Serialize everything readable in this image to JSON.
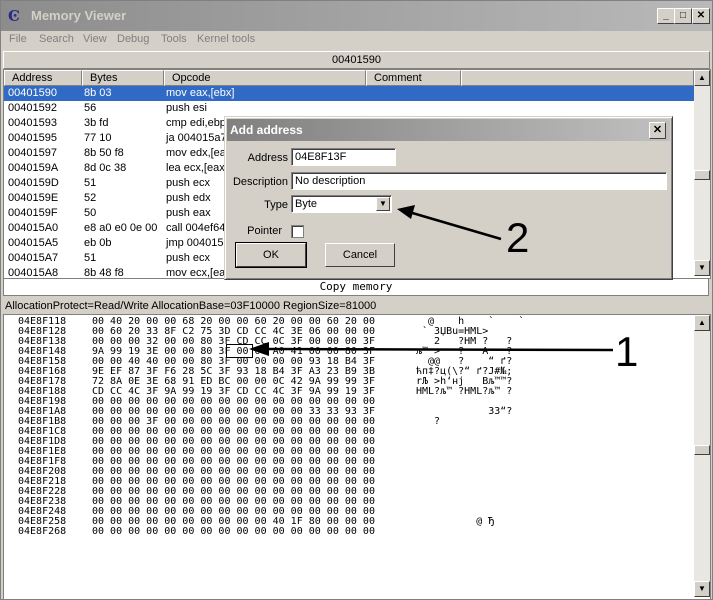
{
  "window": {
    "title": "Memory Viewer",
    "icon": "cheat-engine-icon"
  },
  "menu": [
    "File",
    "Search",
    "View",
    "Debug",
    "Tools",
    "Kernel tools"
  ],
  "address_bar": "00401590",
  "disasm": {
    "columns": [
      "Address",
      "Bytes",
      "Opcode",
      "Comment"
    ],
    "rows": [
      {
        "address": "00401590",
        "bytes": "8b 03",
        "opcode": "mov eax,[ebx]",
        "selected": true
      },
      {
        "address": "00401592",
        "bytes": "56",
        "opcode": "push esi"
      },
      {
        "address": "00401593",
        "bytes": "3b fd",
        "opcode": "cmp edi,ebp"
      },
      {
        "address": "00401595",
        "bytes": "77 10",
        "opcode": "ja 004015a7"
      },
      {
        "address": "00401597",
        "bytes": "8b 50 f8",
        "opcode": "mov edx,[eax"
      },
      {
        "address": "0040159A",
        "bytes": "8d 0c 38",
        "opcode": "lea ecx,[eax"
      },
      {
        "address": "0040159D",
        "bytes": "51",
        "opcode": "push ecx"
      },
      {
        "address": "0040159E",
        "bytes": "52",
        "opcode": "push edx"
      },
      {
        "address": "0040159F",
        "bytes": "50",
        "opcode": "push eax"
      },
      {
        "address": "004015A0",
        "bytes": "e8 a0 e0 0e 00",
        "opcode": "call 004ef64"
      },
      {
        "address": "004015A5",
        "bytes": "eb 0b",
        "opcode": "jmp 004015b"
      },
      {
        "address": "004015A7",
        "bytes": "51",
        "opcode": "push ecx"
      },
      {
        "address": "004015A8",
        "bytes": "8b 48 f8",
        "opcode": "mov ecx,[ea"
      }
    ]
  },
  "copy_memory_label": "Copy memory",
  "status": "AllocationProtect=Read/Write  AllocationBase=03F10000 RegionSize=81000",
  "hex": [
    {
      "addr": "04E8F118",
      "bytes": "00 40 20 00 00 68 20 00 00 60 20 00 00 60 20 00",
      "ascii": "  @    h    `    `"
    },
    {
      "addr": "04E8F128",
      "bytes": "00 60 20 33 8F C2 75 3D CD CC 4C 3E 06 00 00 00",
      "ascii": " ` 3ЏВu=НМL>"
    },
    {
      "addr": "04E8F138",
      "bytes": "00 00 00 32 00 00 80 3F CD CC 0C 3F 00 00 00 3F",
      "ascii": "   2   ?НМ ?   ?"
    },
    {
      "addr": "04E8F148",
      "bytes": "9A 99 19 3E 00 00 80 3F 00 00 A0 41 00 00 80 3F",
      "ascii": "љ™ >   ?   A   ?"
    },
    {
      "addr": "04E8F158",
      "bytes": "00 00 40 40 00 00 80 3F 00 00 00 00 93 18 B4 3F",
      "ascii": "  @@   ?    “ ґ?"
    },
    {
      "addr": "04E8F168",
      "bytes": "9E EF 87 3F F6 28 5C 3F 93 18 B4 3F A3 23 B9 3B",
      "ascii": "ћп‡?ц(\\?“ ґ?Ј#№;"
    },
    {
      "addr": "04E8F178",
      "bytes": "72 8A 0E 3E 68 91 ED BC 00 00 0C 42 9A 99 99 3F",
      "ascii": "rЉ >h‘нј   Bљ™™?"
    },
    {
      "addr": "04E8F188",
      "bytes": "CD CC 4C 3F 9A 99 19 3F CD CC 4C 3F 9A 99 19 3F",
      "ascii": "НМL?љ™ ?НМL?љ™ ?"
    },
    {
      "addr": "04E8F198",
      "bytes": "00 00 00 00 00 00 00 00 00 00 00 00 00 00 00 00",
      "ascii": ""
    },
    {
      "addr": "04E8F1A8",
      "bytes": "00 00 00 00 00 00 00 00 00 00 00 00 33 33 93 3F",
      "ascii": "            33“?"
    },
    {
      "addr": "04E8F1B8",
      "bytes": "00 00 00 3F 00 00 00 00 00 00 00 00 00 00 00 00",
      "ascii": "   ?"
    },
    {
      "addr": "04E8F1C8",
      "bytes": "00 00 00 00 00 00 00 00 00 00 00 00 00 00 00 00",
      "ascii": ""
    },
    {
      "addr": "04E8F1D8",
      "bytes": "00 00 00 00 00 00 00 00 00 00 00 00 00 00 00 00",
      "ascii": ""
    },
    {
      "addr": "04E8F1E8",
      "bytes": "00 00 00 00 00 00 00 00 00 00 00 00 00 00 00 00",
      "ascii": ""
    },
    {
      "addr": "04E8F1F8",
      "bytes": "00 00 00 00 00 00 00 00 00 00 00 00 00 00 00 00",
      "ascii": ""
    },
    {
      "addr": "04E8F208",
      "bytes": "00 00 00 00 00 00 00 00 00 00 00 00 00 00 00 00",
      "ascii": ""
    },
    {
      "addr": "04E8F218",
      "bytes": "00 00 00 00 00 00 00 00 00 00 00 00 00 00 00 00",
      "ascii": ""
    },
    {
      "addr": "04E8F228",
      "bytes": "00 00 00 00 00 00 00 00 00 00 00 00 00 00 00 00",
      "ascii": ""
    },
    {
      "addr": "04E8F238",
      "bytes": "00 00 00 00 00 00 00 00 00 00 00 00 00 00 00 00",
      "ascii": ""
    },
    {
      "addr": "04E8F248",
      "bytes": "00 00 00 00 00 00 00 00 00 00 00 00 00 00 00 00",
      "ascii": ""
    },
    {
      "addr": "04E8F258",
      "bytes": "00 00 00 00 00 00 00 00 00 00 40 1F 80 00 00 00",
      "ascii": "          @ Ђ"
    },
    {
      "addr": "04E8F268",
      "bytes": "00 00 00 00 00 00 00 00 00 00 00 00 00 00 00 00",
      "ascii": ""
    }
  ],
  "dialog": {
    "title": "Add address",
    "address_label": "Address",
    "address_value": "04E8F13F",
    "description_label": "Description",
    "description_value": "No description",
    "type_label": "Type",
    "type_value": "Byte",
    "pointer_label": "Pointer",
    "ok_label": "OK",
    "cancel_label": "Cancel"
  },
  "callouts": [
    "1",
    "2"
  ]
}
